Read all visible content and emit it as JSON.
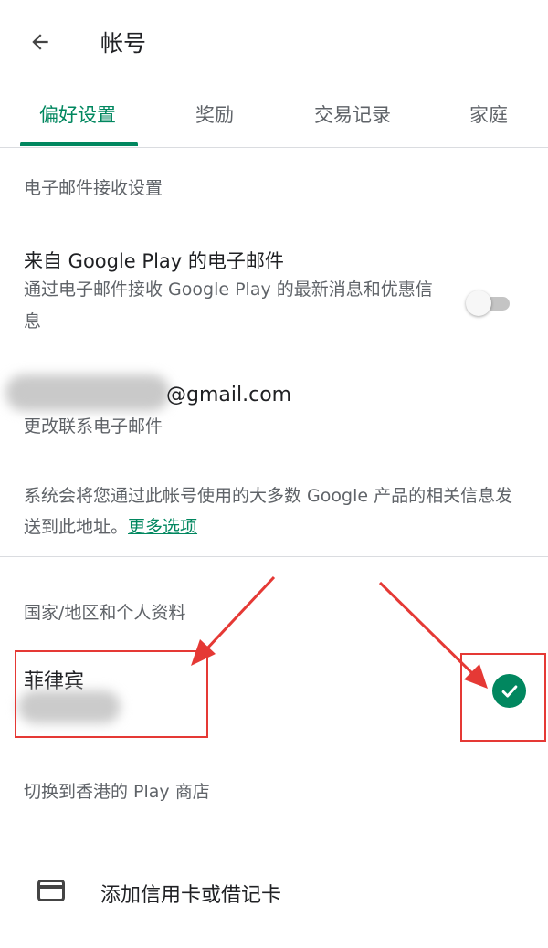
{
  "header": {
    "title": "帐号",
    "back_icon": "arrow-back-icon"
  },
  "tabs": [
    {
      "label": "偏好设置",
      "active": true
    },
    {
      "label": "奖励",
      "active": false
    },
    {
      "label": "交易记录",
      "active": false
    },
    {
      "label": "家庭",
      "active": false
    }
  ],
  "email_settings": {
    "section_title": "电子邮件接收设置",
    "pref_title": "来自 Google Play 的电子邮件",
    "pref_desc": "通过电子邮件接收 Google Play 的最新消息和优惠信息",
    "toggle_on": false,
    "email_domain": "@gmail.com",
    "change_email": "更改联系电子邮件",
    "info_text": "系统会将您通过此帐号使用的大多数 Google 产品的相关信息发送到此地址。",
    "info_link": "更多选项"
  },
  "country": {
    "section_title": "国家/地区和个人资料",
    "name": "菲律宾",
    "selected": true,
    "switch_store": "切换到香港的 Play 商店"
  },
  "payment": {
    "add_card": "添加信用卡或借记卡",
    "card_icon": "credit-card-icon"
  },
  "colors": {
    "accent": "#01875f",
    "annotation": "#e53935"
  }
}
